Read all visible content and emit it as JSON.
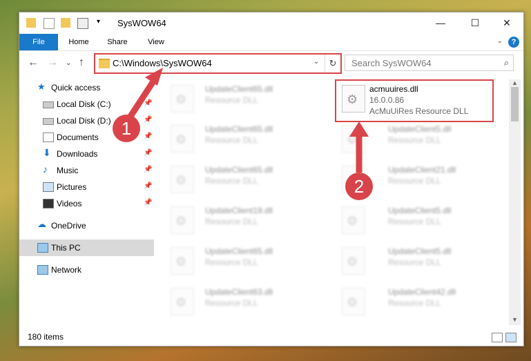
{
  "window": {
    "title": "SysWOW64"
  },
  "ribbon": {
    "tabs": [
      "File",
      "Home",
      "Share",
      "View"
    ]
  },
  "address": {
    "path": "C:\\Windows\\SysWOW64"
  },
  "search": {
    "placeholder": "Search SysWOW64"
  },
  "sidebar": {
    "items": [
      {
        "label": "Quick access"
      },
      {
        "label": "Local Disk (C:)"
      },
      {
        "label": "Local Disk (D:)"
      },
      {
        "label": "Documents"
      },
      {
        "label": "Downloads"
      },
      {
        "label": "Music"
      },
      {
        "label": "Pictures"
      },
      {
        "label": "Videos"
      },
      {
        "label": "OneDrive"
      },
      {
        "label": "This PC"
      },
      {
        "label": "Network"
      }
    ]
  },
  "files": {
    "left": [
      {
        "name": "UpdateClient65.dll",
        "type": "Resource DLL"
      },
      {
        "name": "UpdateClient65.dll",
        "type": "Resource DLL"
      },
      {
        "name": "UpdateClient65.dll",
        "type": "Resource DLL"
      },
      {
        "name": "UpdateClient19.dll",
        "type": "Resource DLL"
      },
      {
        "name": "UpdateClient65.dll",
        "type": "Resource DLL"
      },
      {
        "name": "UpdateClient63.dll",
        "type": "Resource DLL"
      }
    ],
    "right": [
      {
        "name": "UpdateClient5.dll",
        "type": "Resource DLL"
      },
      {
        "name": "UpdateClient21.dll",
        "type": "Resource DLL"
      },
      {
        "name": "UpdateClient5.dll",
        "type": "Resource DLL"
      },
      {
        "name": "UpdateClient5.dll",
        "type": "Resource DLL"
      },
      {
        "name": "UpdateClient42.dll",
        "type": "Resource DLL"
      }
    ],
    "highlighted": {
      "name": "acmuuires.dll",
      "version": "16.0.0.86",
      "description": "AcMuUiRes Resource DLL"
    }
  },
  "status": {
    "items": "180 items"
  },
  "annotations": {
    "step1": "1",
    "step2": "2"
  },
  "colors": {
    "accent": "#1979ca",
    "annotation": "#d9444a"
  }
}
